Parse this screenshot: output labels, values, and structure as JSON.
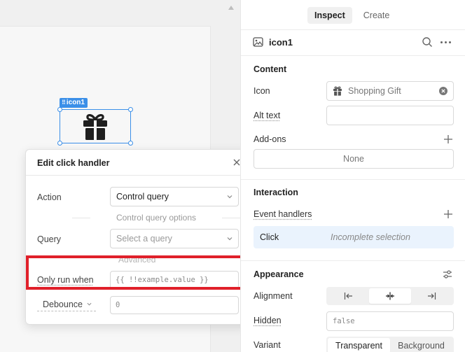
{
  "canvas": {
    "component_tag": "icon1"
  },
  "popover": {
    "title": "Edit click handler",
    "action_label": "Action",
    "action_value": "Control query",
    "section_label": "Control query options",
    "query_label": "Query",
    "query_placeholder": "Select a query",
    "advanced_label": "Advanced",
    "only_run_when_label": "Only run when",
    "only_run_when_value": "{{ !!example.value }}",
    "debounce_label": "Debounce",
    "debounce_value": "0"
  },
  "inspector": {
    "tabs": [
      {
        "label": "Inspect",
        "active": true
      },
      {
        "label": "Create",
        "active": false
      }
    ],
    "component_name": "icon1",
    "content": {
      "title": "Content",
      "icon_label": "Icon",
      "icon_value": "Shopping Gift",
      "alt_text_label": "Alt text",
      "alt_text_value": "",
      "addons_label": "Add-ons",
      "addons_value": "None"
    },
    "interaction": {
      "title": "Interaction",
      "event_handlers_label": "Event handlers",
      "handler_event": "Click",
      "handler_status": "Incomplete selection"
    },
    "appearance": {
      "title": "Appearance",
      "alignment_label": "Alignment",
      "hidden_label": "Hidden",
      "hidden_value": "false",
      "variant_label": "Variant",
      "variant_options": [
        "Transparent",
        "Background"
      ],
      "variant_selected": "Transparent"
    }
  },
  "colors": {
    "accent": "#3b8fe8",
    "highlight_box": "#e0202a",
    "handler_bg": "#eaf3fd"
  }
}
